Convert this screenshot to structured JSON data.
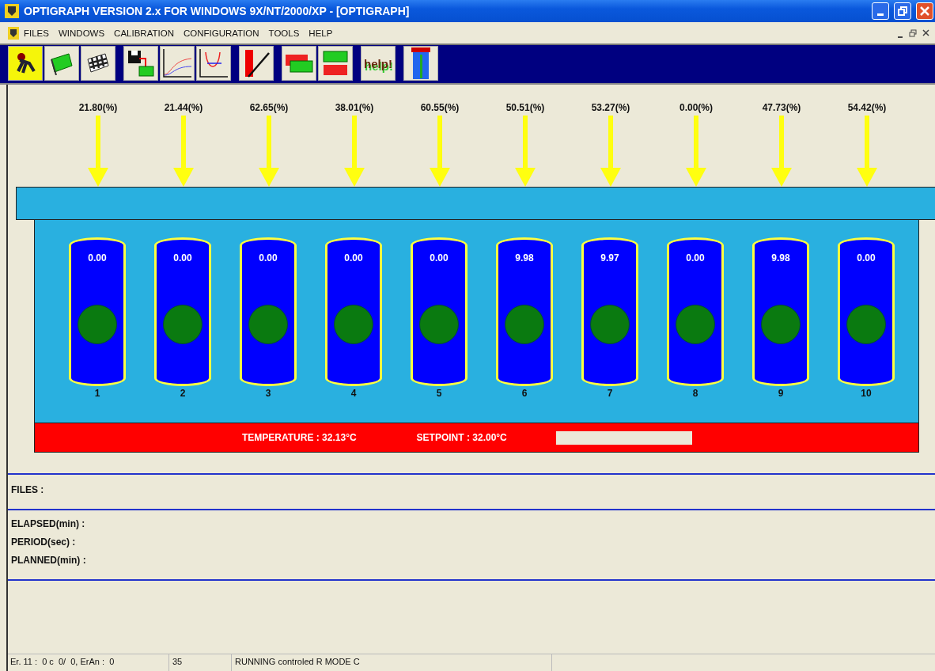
{
  "window": {
    "title": "OPTIGRAPH VERSION 2.x FOR WINDOWS 9X/NT/2000/XP - [OPTIGRAPH]"
  },
  "menu": [
    "FILES",
    "WINDOWS",
    "CALIBRATION",
    "CONFIGURATION",
    "TOOLS",
    "HELP"
  ],
  "toolbar": [
    {
      "buttons": [
        {
          "kind": "runner"
        },
        {
          "kind": "flag"
        },
        {
          "kind": "checkered"
        }
      ]
    },
    {
      "buttons": [
        {
          "kind": "save"
        },
        {
          "kind": "linechart"
        },
        {
          "kind": "curvechart"
        }
      ]
    },
    {
      "buttons": [
        {
          "kind": "redline"
        }
      ]
    },
    {
      "buttons": [
        {
          "kind": "panels"
        },
        {
          "kind": "panels2"
        }
      ]
    },
    {
      "buttons": [
        {
          "kind": "help",
          "label": "help!"
        }
      ]
    },
    {
      "buttons": [
        {
          "kind": "exit"
        }
      ]
    }
  ],
  "channels": [
    {
      "reading": "21.80(%)",
      "value": "0.00",
      "number": "1"
    },
    {
      "reading": "21.44(%)",
      "value": "0.00",
      "number": "2"
    },
    {
      "reading": "62.65(%)",
      "value": "0.00",
      "number": "3"
    },
    {
      "reading": "38.01(%)",
      "value": "0.00",
      "number": "4"
    },
    {
      "reading": "60.55(%)",
      "value": "0.00",
      "number": "5"
    },
    {
      "reading": "50.51(%)",
      "value": "9.98",
      "number": "6"
    },
    {
      "reading": "53.27(%)",
      "value": "9.97",
      "number": "7"
    },
    {
      "reading": "0.00(%)",
      "value": "0.00",
      "number": "8"
    },
    {
      "reading": "47.73(%)",
      "value": "9.98",
      "number": "9"
    },
    {
      "reading": "54.42(%)",
      "value": "0.00",
      "number": "10"
    }
  ],
  "temperature_band": {
    "temperature": "TEMPERATURE : 32.13°C",
    "setpoint": "SETPOINT : 32.00°C",
    "progress": {
      "level": 0
    }
  },
  "files_label": "FILES :",
  "timing": [
    "ELAPSED(min) :",
    "PERIOD(sec) :",
    "PLANNED(min) :"
  ],
  "status_bar": [
    "Er. 11 :  0 c  0/  0, ErAn :  0",
    "35",
    "RUNNING controled R MODE C"
  ]
}
